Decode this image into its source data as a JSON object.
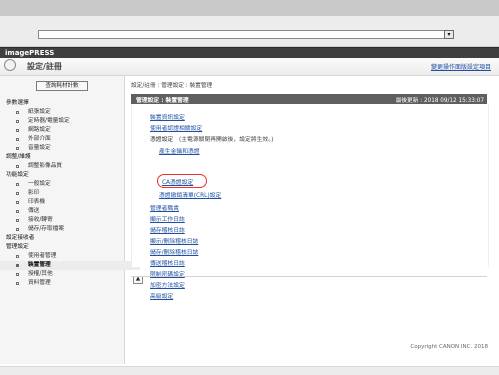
{
  "window": {
    "address_dropdown_icon": "chevron-down-icon"
  },
  "app": {
    "brand": "imagePRESS"
  },
  "header": {
    "icon": "gear-icon",
    "title": "設定/註冊",
    "right_link": "變更操作面版設定項目"
  },
  "sidebar": {
    "check_counter_button": "查詢耗材計數",
    "items": [
      {
        "type": "section",
        "label": "參數選擇"
      },
      {
        "type": "item",
        "label": "紙張設定"
      },
      {
        "type": "item",
        "label": "定時器/電量設定"
      },
      {
        "type": "item",
        "label": "網路設定"
      },
      {
        "type": "item",
        "label": "外部介面"
      },
      {
        "type": "item",
        "label": "音量設定"
      },
      {
        "type": "section",
        "label": "調整/維護"
      },
      {
        "type": "item",
        "label": "調整影像品質"
      },
      {
        "type": "section",
        "label": "功能設定"
      },
      {
        "type": "item",
        "label": "一般設定"
      },
      {
        "type": "item",
        "label": "影印"
      },
      {
        "type": "item",
        "label": "印表機"
      },
      {
        "type": "item",
        "label": "傳送"
      },
      {
        "type": "item",
        "label": "接收/轉寄"
      },
      {
        "type": "item",
        "label": "儲存/存取檔案"
      },
      {
        "type": "section",
        "label": "設定接收者"
      },
      {
        "type": "section",
        "label": "管理設定"
      },
      {
        "type": "item",
        "label": "使用者管理"
      },
      {
        "type": "item",
        "label": "裝置管理",
        "active": true
      },
      {
        "type": "item",
        "label": "授權/其他"
      },
      {
        "type": "item",
        "label": "資料管理"
      }
    ]
  },
  "main": {
    "breadcrumb": "設定/註冊 : 管理設定 : 裝置管理",
    "panel_title": "管理設定 : 裝置管理",
    "last_updated": "最後更新 : 2018 09/12 15:33:07",
    "links": [
      "裝置資訊設定",
      "使用者認證相關設定",
      "憑證設定",
      "(主電源關閉再開啟後，設定將生效。)",
      "產生金鑰和憑證",
      "CA憑證設定",
      "憑證撤銷清單(CRL)設定",
      "管理者職責",
      "顯示工作日誌",
      "儲存稽核日誌",
      "顯示/刪除稽核日誌",
      "儲存/刪除稽核日誌",
      "傳送稽核日誌",
      "限制密碼設定",
      "加密方法設定",
      "高級設定"
    ],
    "scroll_button": "▲",
    "copyright": "Copyright CANON INC. 2018"
  }
}
